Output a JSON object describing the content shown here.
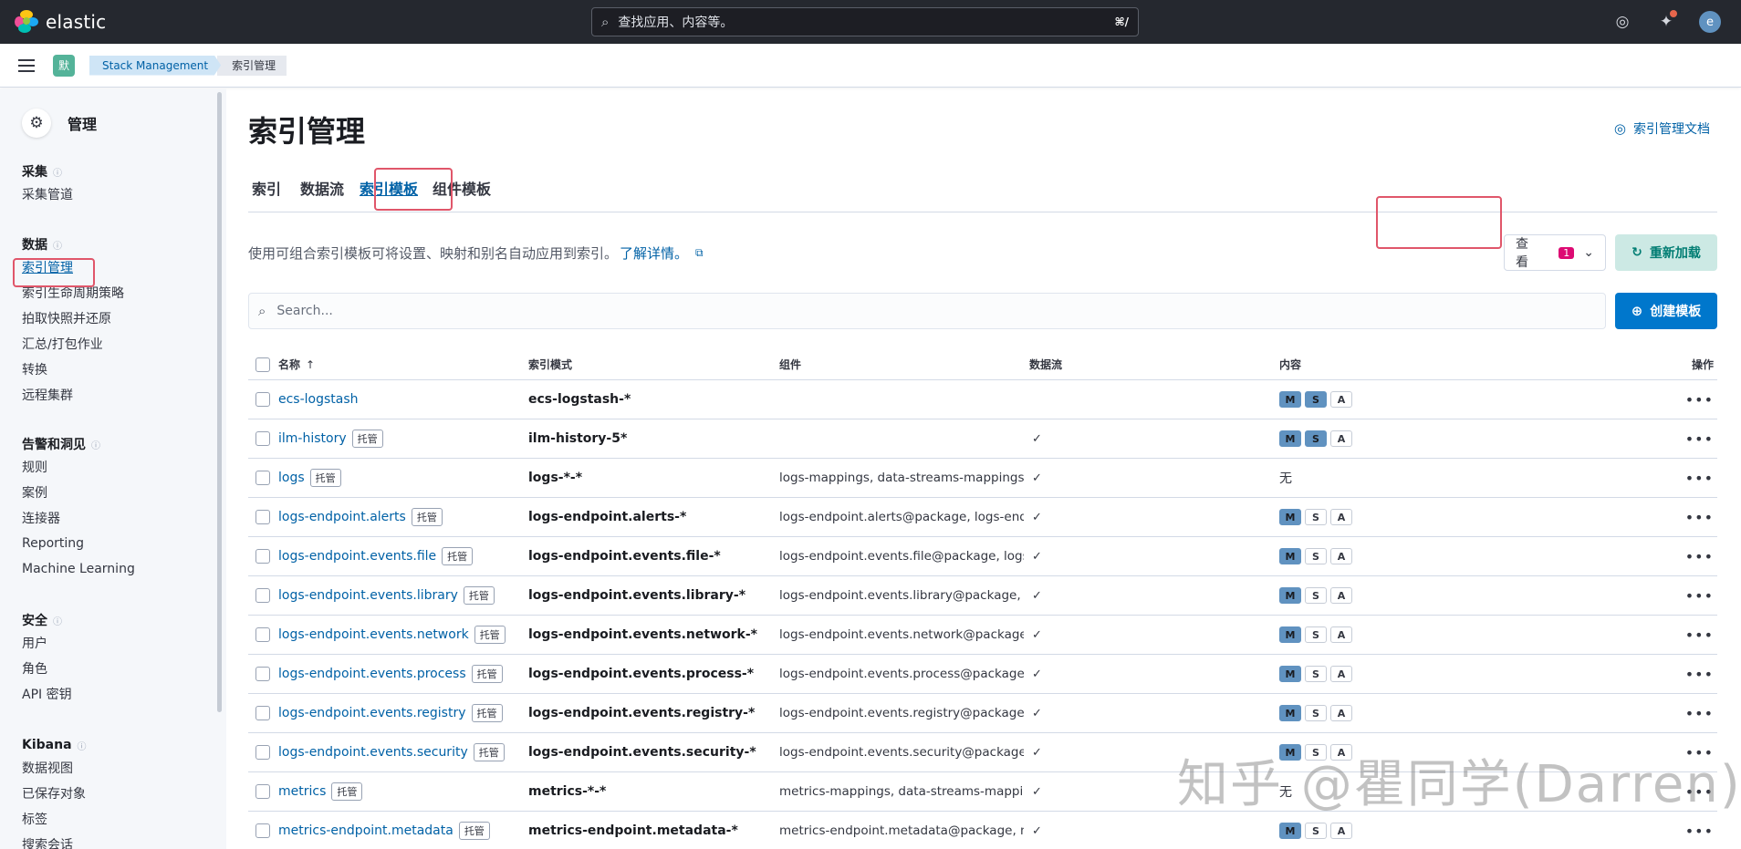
{
  "header": {
    "brand": "elastic",
    "search_placeholder": "查找应用、内容等。",
    "search_shortcut": "⌘/",
    "avatar_initial": "e"
  },
  "breadcrumbs": {
    "space": "默",
    "items": [
      "Stack Management",
      "索引管理"
    ]
  },
  "sidebar": {
    "title": "管理",
    "groups": [
      {
        "title": "采集",
        "items": [
          "采集管道"
        ]
      },
      {
        "title": "数据",
        "items": [
          "索引管理",
          "索引生命周期策略",
          "拍取快照并还原",
          "汇总/打包作业",
          "转换",
          "远程集群"
        ]
      },
      {
        "title": "告警和洞见",
        "items": [
          "规则",
          "案例",
          "连接器",
          "Reporting",
          "Machine Learning"
        ]
      },
      {
        "title": "安全",
        "items": [
          "用户",
          "角色",
          "API 密钥"
        ]
      },
      {
        "title": "Kibana",
        "items": [
          "数据视图",
          "已保存对象",
          "标签",
          "搜索会话"
        ]
      }
    ]
  },
  "main": {
    "title": "索引管理",
    "docs_link": "索引管理文档",
    "tabs": [
      "索引",
      "数据流",
      "索引模板",
      "组件模板"
    ],
    "description": "使用可组合索引模板可将设置、映射和别名自动应用到索引。",
    "learn_more": "了解详情。",
    "view_label": "查看",
    "view_count": "1",
    "reload_label": "重新加载",
    "search_placeholder": "Search...",
    "create_label": "创建模板",
    "columns": [
      "名称",
      "索引模式",
      "组件",
      "数据流",
      "内容",
      "操作"
    ],
    "managed_label": "托管",
    "none_label": "无",
    "rows": [
      {
        "name": "ecs-logstash",
        "managed": false,
        "pattern": "ecs-logstash-*",
        "components": "",
        "data_stream": false,
        "content": [
          "M",
          "S",
          "A"
        ],
        "content_on": [
          true,
          true,
          false
        ]
      },
      {
        "name": "ilm-history",
        "managed": true,
        "pattern": "ilm-history-5*",
        "components": "",
        "data_stream": true,
        "content": [
          "M",
          "S",
          "A"
        ],
        "content_on": [
          true,
          true,
          false
        ]
      },
      {
        "name": "logs",
        "managed": true,
        "pattern": "logs-*-*",
        "components": "logs-mappings, data-streams-mappings, logs-settings",
        "data_stream": true,
        "content": [],
        "content_on": []
      },
      {
        "name": "logs-endpoint.alerts",
        "managed": true,
        "pattern": "logs-endpoint.alerts-*",
        "components": "logs-endpoint.alerts@package, logs-endpoint.alerts@custom",
        "data_stream": true,
        "content": [
          "M",
          "S",
          "A"
        ],
        "content_on": [
          true,
          false,
          false
        ]
      },
      {
        "name": "logs-endpoint.events.file",
        "managed": true,
        "pattern": "logs-endpoint.events.file-*",
        "components": "logs-endpoint.events.file@package, logs-endpoint.events.file@custom",
        "data_stream": true,
        "content": [
          "M",
          "S",
          "A"
        ],
        "content_on": [
          true,
          false,
          false
        ]
      },
      {
        "name": "logs-endpoint.events.library",
        "managed": true,
        "pattern": "logs-endpoint.events.library-*",
        "components": "logs-endpoint.events.library@package, logs-endpoint.events.library@custom",
        "data_stream": true,
        "content": [
          "M",
          "S",
          "A"
        ],
        "content_on": [
          true,
          false,
          false
        ]
      },
      {
        "name": "logs-endpoint.events.network",
        "managed": true,
        "pattern": "logs-endpoint.events.network-*",
        "components": "logs-endpoint.events.network@package, logs-endpoint.events.network@custom",
        "data_stream": true,
        "content": [
          "M",
          "S",
          "A"
        ],
        "content_on": [
          true,
          false,
          false
        ]
      },
      {
        "name": "logs-endpoint.events.process",
        "managed": true,
        "pattern": "logs-endpoint.events.process-*",
        "components": "logs-endpoint.events.process@package, logs-endpoint.events.process@custom",
        "data_stream": true,
        "content": [
          "M",
          "S",
          "A"
        ],
        "content_on": [
          true,
          false,
          false
        ]
      },
      {
        "name": "logs-endpoint.events.registry",
        "managed": true,
        "pattern": "logs-endpoint.events.registry-*",
        "components": "logs-endpoint.events.registry@package, logs-endpoint.events.registry@custom",
        "data_stream": true,
        "content": [
          "M",
          "S",
          "A"
        ],
        "content_on": [
          true,
          false,
          false
        ]
      },
      {
        "name": "logs-endpoint.events.security",
        "managed": true,
        "pattern": "logs-endpoint.events.security-*",
        "components": "logs-endpoint.events.security@package, logs-endpoint.events.security@custom",
        "data_stream": true,
        "content": [
          "M",
          "S",
          "A"
        ],
        "content_on": [
          true,
          false,
          false
        ]
      },
      {
        "name": "metrics",
        "managed": true,
        "pattern": "metrics-*-*",
        "components": "metrics-mappings, data-streams-mappings, metrics-settings",
        "data_stream": true,
        "content": [],
        "content_on": []
      },
      {
        "name": "metrics-endpoint.metadata",
        "managed": true,
        "pattern": "metrics-endpoint.metadata-*",
        "components": "metrics-endpoint.metadata@package, metrics-endpoint.metadata@custom",
        "data_stream": true,
        "content": [
          "M",
          "S",
          "A"
        ],
        "content_on": [
          true,
          false,
          false
        ]
      }
    ]
  },
  "watermark": "知乎 @瞿同学(Darren)",
  "colors": {
    "header_bg": "#25282f",
    "link": "#0061a6",
    "primary": "#0077cc",
    "highlight": "#e0566a"
  }
}
